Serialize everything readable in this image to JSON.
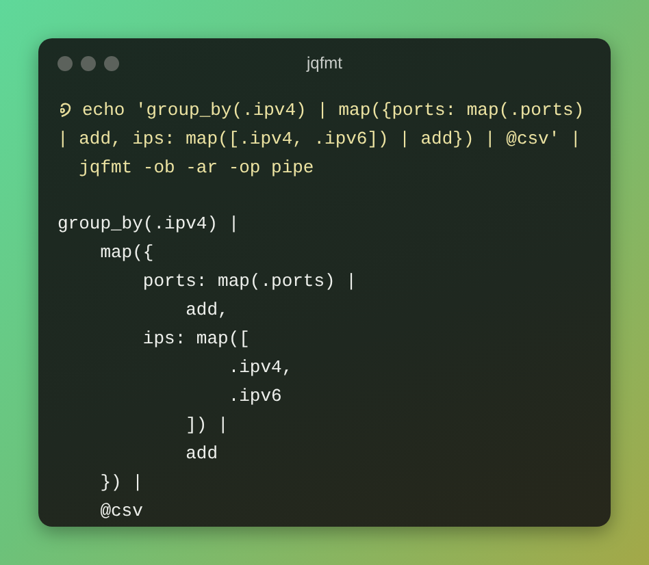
{
  "window": {
    "title": "jqfmt"
  },
  "command": {
    "lines": [
      "echo 'group_by(.ipv4) | map({ports: map(.ports)",
      "| add, ips: map([.ipv4, .ipv6]) | add}) | @csv' |",
      "  jqfmt -ob -ar -op pipe"
    ]
  },
  "output": {
    "lines": [
      "group_by(.ipv4) |",
      "    map({",
      "        ports: map(.ports) |",
      "            add,",
      "        ips: map([",
      "                .ipv4,",
      "                .ipv6",
      "            ]) |",
      "            add",
      "    }) |",
      "    @csv"
    ]
  }
}
